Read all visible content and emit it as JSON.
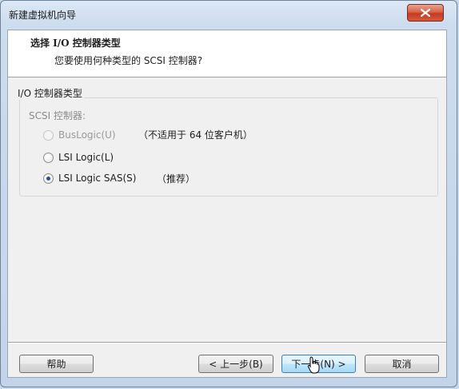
{
  "window": {
    "title": "新建虚拟机向导",
    "close_icon": "close-icon"
  },
  "header": {
    "title": "选择 I/O 控制器类型",
    "subtitle": "您要使用何种类型的 SCSI 控制器?"
  },
  "group": {
    "legend": "I/O 控制器类型",
    "scsi_label": "SCSI 控制器:",
    "options": [
      {
        "label": "BusLogic(U)",
        "note": "（不适用于 64 位客户机）",
        "selected": false,
        "enabled": false
      },
      {
        "label": "LSI Logic(L)",
        "note": "",
        "selected": false,
        "enabled": true
      },
      {
        "label": "LSI Logic SAS(S)",
        "note": "（推荐）",
        "selected": true,
        "enabled": true
      }
    ]
  },
  "buttons": {
    "help": "帮助",
    "back": "< 上一步(B)",
    "next": "下一步(N) >",
    "cancel": "取消"
  },
  "colors": {
    "title_gradient": "#cddcee",
    "close_red": "#c43b22",
    "radio_dot": "#2a4f87",
    "primary_border": "#3c7fb1"
  }
}
